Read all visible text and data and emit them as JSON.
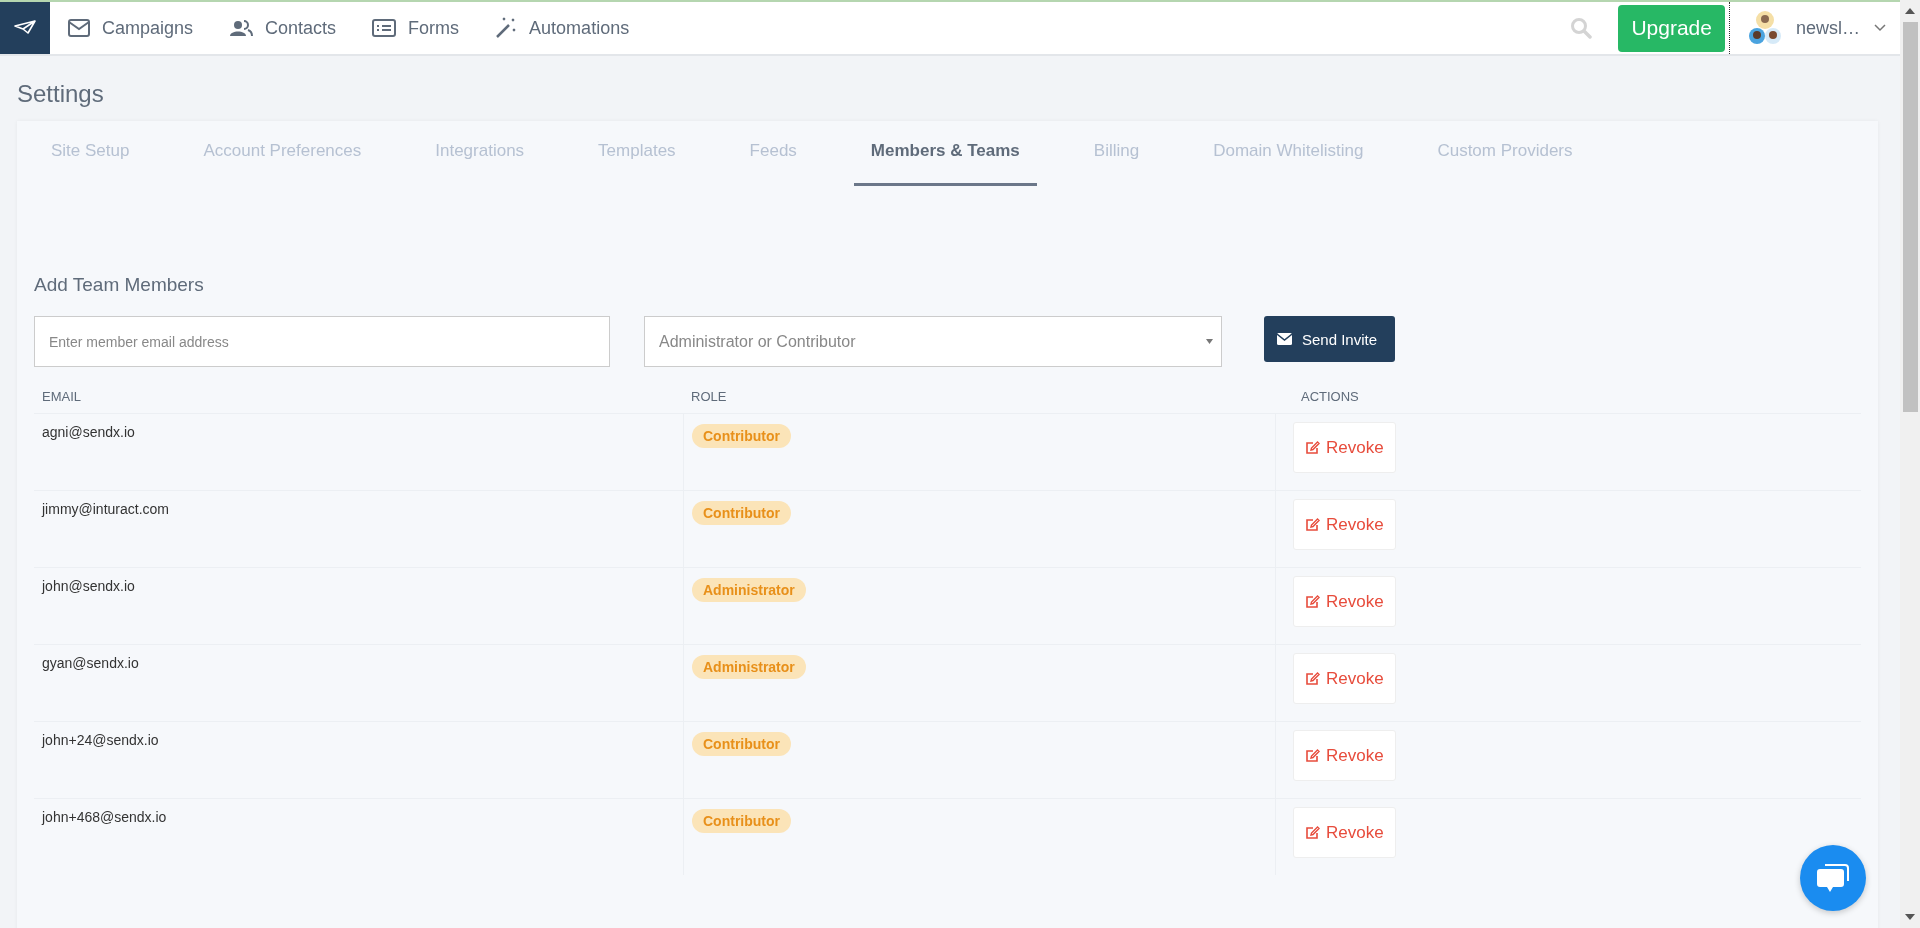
{
  "nav": {
    "items": [
      {
        "label": "Campaigns"
      },
      {
        "label": "Contacts"
      },
      {
        "label": "Forms"
      },
      {
        "label": "Automations"
      }
    ],
    "upgrade": "Upgrade",
    "user": "newsl…"
  },
  "page_title": "Settings",
  "tabs": [
    {
      "label": "Site Setup",
      "selected": false
    },
    {
      "label": "Account Preferences",
      "selected": false
    },
    {
      "label": "Integrations",
      "selected": false
    },
    {
      "label": "Templates",
      "selected": false
    },
    {
      "label": "Feeds",
      "selected": false
    },
    {
      "label": "Members & Teams",
      "selected": true
    },
    {
      "label": "Billing",
      "selected": false
    },
    {
      "label": "Domain Whitelisting",
      "selected": false
    },
    {
      "label": "Custom Providers",
      "selected": false
    }
  ],
  "invite": {
    "heading": "Add Team Members",
    "email": {
      "placeholder": "Enter member email address"
    },
    "role": {
      "placeholder": "Administrator or Contributor"
    },
    "button": "Send Invite"
  },
  "table": {
    "columns": [
      "EMAIL",
      "ROLE",
      "ACTIONS"
    ],
    "rows": [
      {
        "email": "agni@sendx.io",
        "role": "Contributor",
        "action": "Revoke"
      },
      {
        "email": "jimmy@inturact.com",
        "role": "Contributor",
        "action": "Revoke"
      },
      {
        "email": "john@sendx.io",
        "role": "Administrator",
        "action": "Revoke"
      },
      {
        "email": "gyan@sendx.io",
        "role": "Administrator",
        "action": "Revoke"
      },
      {
        "email": "john+24@sendx.io",
        "role": "Contributor",
        "action": "Revoke"
      },
      {
        "email": "john+468@sendx.io",
        "role": "Contributor",
        "action": "Revoke"
      }
    ]
  }
}
